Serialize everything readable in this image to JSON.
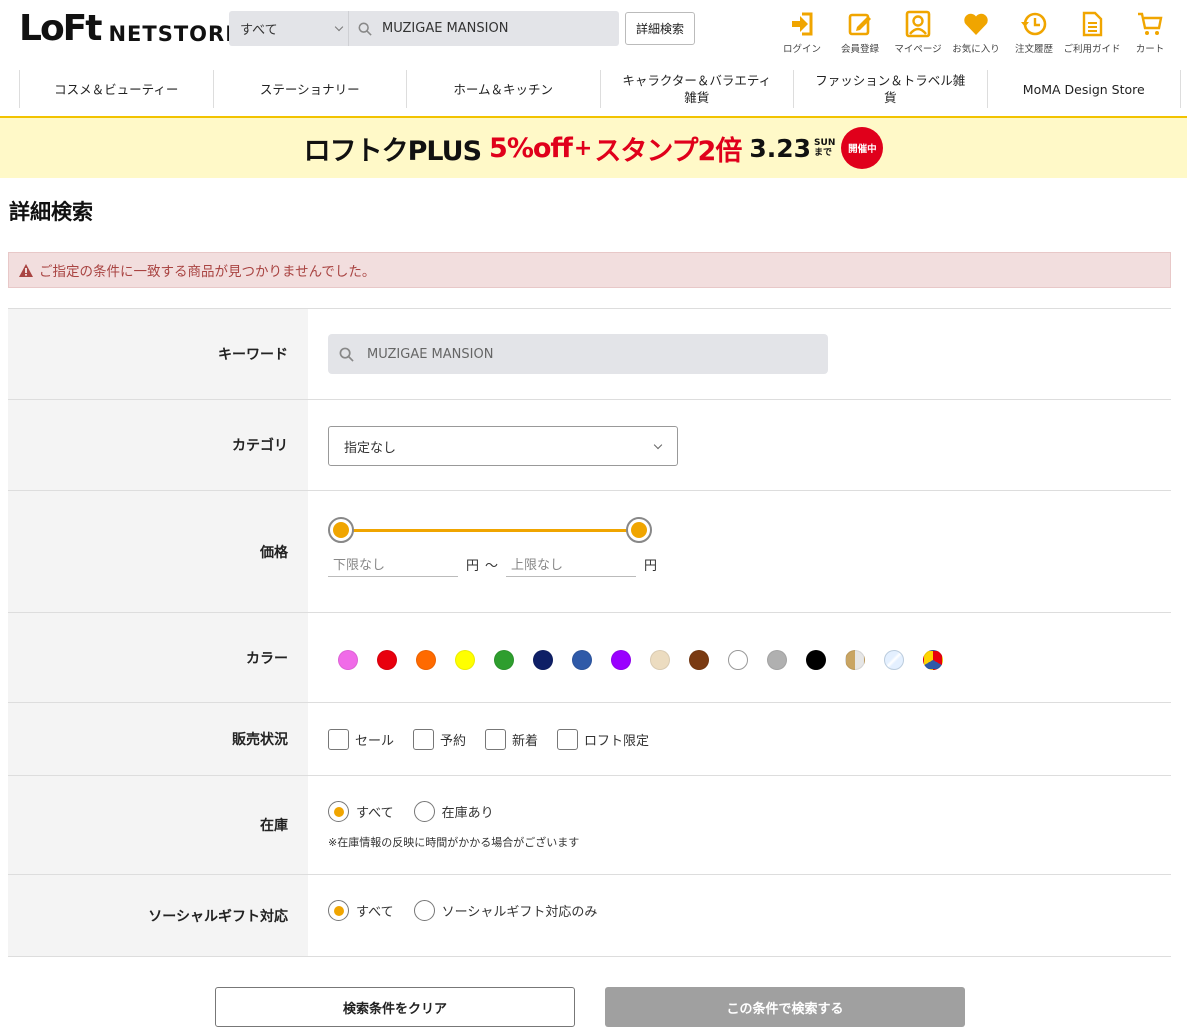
{
  "header": {
    "logo_loft": "LoFt",
    "logo_netstore": "NETSTORE",
    "search_category": "すべて",
    "search_query": "MUZIGAE MANSION",
    "advanced_search_label": "詳細検索",
    "icons": [
      {
        "label": "ログイン",
        "icon": "login-icon"
      },
      {
        "label": "会員登録",
        "icon": "register-icon"
      },
      {
        "label": "マイページ",
        "icon": "mypage-icon"
      },
      {
        "label": "お気に入り",
        "icon": "heart-icon"
      },
      {
        "label": "注文履歴",
        "icon": "history-icon"
      },
      {
        "label": "ご利用ガイド",
        "icon": "guide-icon"
      },
      {
        "label": "カート",
        "icon": "cart-icon"
      }
    ]
  },
  "category_nav": [
    "コスメ＆ビューティー",
    "ステーショナリー",
    "ホーム＆キッチン",
    "キャラクター＆バラエティ雑貨",
    "ファッション＆トラベル雑貨",
    "MoMA Design Store"
  ],
  "banner": {
    "title": "ロフトクPLUS",
    "discount": "5%off",
    "plus": "+",
    "stamp": "スタンプ2倍",
    "date": "3.23",
    "weekday": "SUN",
    "until": "まで",
    "badge": "開催中"
  },
  "page": {
    "title": "詳細検索",
    "alert": "ご指定の条件に一致する商品が見つかりませんでした。"
  },
  "form": {
    "keyword": {
      "label": "キーワード",
      "value": "MUZIGAE MANSION"
    },
    "category": {
      "label": "カテゴリ",
      "value": "指定なし"
    },
    "price": {
      "label": "価格",
      "min_placeholder": "下限なし",
      "max_placeholder": "上限なし",
      "unit": "円",
      "separator": "～",
      "slider_min_fraction": 0,
      "slider_max_fraction": 1
    },
    "color": {
      "label": "カラー",
      "swatches": [
        "#f06be8",
        "#e8000d",
        "#ff6a00",
        "#ffff00",
        "#2e9e2e",
        "#0e1f66",
        "#2f5aa8",
        "#9a00ff",
        "#ecdcc0",
        "#7a3a12",
        "#ffffff",
        "#b0b0b0",
        "#000000",
        "gold-split",
        "clear",
        "multi"
      ]
    },
    "status": {
      "label": "販売状況",
      "options": [
        "セール",
        "予約",
        "新着",
        "ロフト限定"
      ]
    },
    "stock": {
      "label": "在庫",
      "options": [
        "すべて",
        "在庫あり"
      ],
      "selected": 0,
      "note": "※在庫情報の反映に時間がかかる場合がございます"
    },
    "social_gift": {
      "label": "ソーシャルギフト対応",
      "options": [
        "すべて",
        "ソーシャルギフト対応のみ"
      ],
      "selected": 0
    }
  },
  "buttons": {
    "clear": "検索条件をクリア",
    "search": "この条件で検索する"
  },
  "colors": {
    "accent": "#f0a500",
    "banner_bg": "#fff9c8",
    "banner_red": "#e0001b",
    "alert_bg": "#f2dede",
    "alert_text": "#a94442",
    "disabled_button": "#a0a0a0"
  }
}
